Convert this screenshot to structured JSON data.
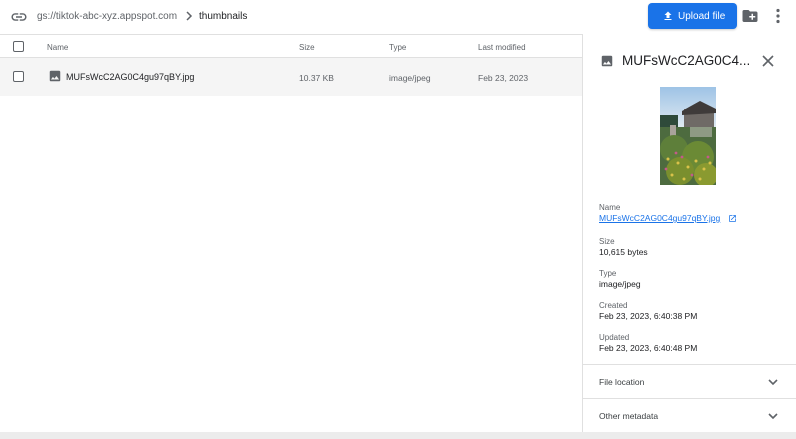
{
  "topbar": {
    "bucket_path": "gs://tiktok-abc-xyz.appspot.com",
    "current_folder": "thumbnails",
    "upload_label": "Upload file"
  },
  "table": {
    "columns": {
      "name": "Name",
      "size": "Size",
      "type": "Type",
      "modified": "Last modified"
    },
    "rows": [
      {
        "name": "MUFsWcC2AG0C4gu97qBY.jpg",
        "size": "10.37 KB",
        "type": "image/jpeg",
        "modified": "Feb 23, 2023"
      }
    ]
  },
  "panel": {
    "title": "MUFsWcC2AG0C4...",
    "name_label": "Name",
    "name_value": "MUFsWcC2AG0C4gu97qBY.jpg",
    "size_label": "Size",
    "size_value": "10,615 bytes",
    "type_label": "Type",
    "type_value": "image/jpeg",
    "created_label": "Created",
    "created_value": "Feb 23, 2023, 6:40:38 PM",
    "updated_label": "Updated",
    "updated_value": "Feb 23, 2023, 6:40:48 PM",
    "sections": [
      "File location",
      "Other metadata"
    ]
  },
  "colors": {
    "accent": "#1a73e8",
    "text": "#202124",
    "muted": "#5f6368",
    "row_hover": "#f5f5f5"
  },
  "icons": [
    "link-icon",
    "chevron-right-icon",
    "upload-icon",
    "new-folder-icon",
    "more-vert-icon",
    "image-file-icon",
    "close-icon",
    "open-in-new-icon",
    "chevron-down-icon"
  ]
}
